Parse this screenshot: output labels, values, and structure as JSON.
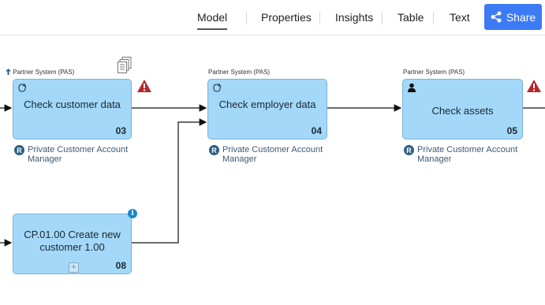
{
  "header": {
    "tabs": [
      {
        "label": "Model",
        "active": true
      },
      {
        "label": "Properties",
        "active": false
      },
      {
        "label": "Insights",
        "active": false
      },
      {
        "label": "Table",
        "active": false
      },
      {
        "label": "Text",
        "active": false
      }
    ],
    "share_label": "Share",
    "share_icon": "share-icon",
    "accent_color": "#3d7bf5"
  },
  "diagram": {
    "task_fill": "#a3d8f9",
    "tasks": [
      {
        "system": "Partner System (PAS)",
        "title": "Check customer data",
        "number": "03",
        "icon": "hand-icon",
        "role_badge": "R",
        "role": "Private Customer Account Manager",
        "warning": true
      },
      {
        "system": "Partner System (PAS)",
        "title": "Check employer data",
        "number": "04",
        "icon": "hand-icon",
        "role_badge": "R",
        "role": "Private Customer Account Manager",
        "warning": false
      },
      {
        "system": "Partner System (PAS)",
        "title": "Check assets",
        "number": "05",
        "icon": "user-icon",
        "role_badge": "R",
        "role": "Private Customer Account Manager",
        "warning": true
      },
      {
        "system": "",
        "title": "CP.01.00 Create new customer 1.00",
        "number": "08",
        "icon": "",
        "role_badge": "",
        "role": "",
        "warning": false,
        "info": true,
        "subprocess": true
      }
    ]
  }
}
